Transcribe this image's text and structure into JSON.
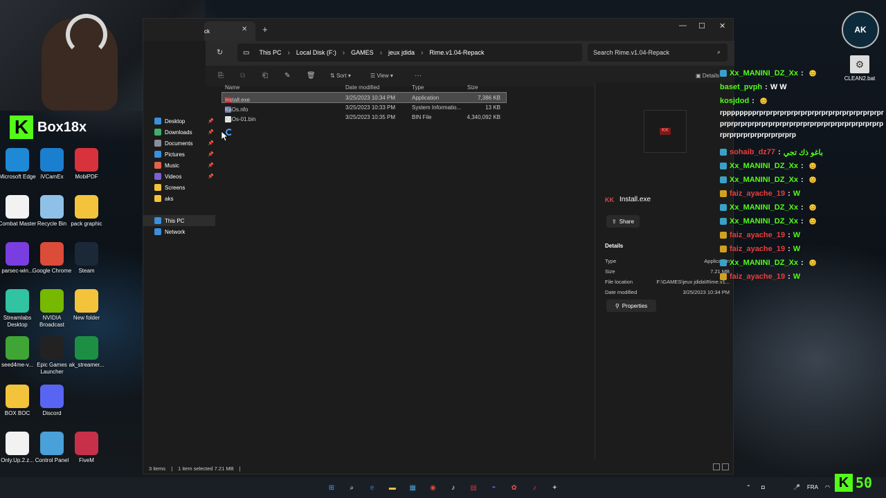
{
  "streamer": {
    "brand": "Box18x",
    "kick_count": "50",
    "logo_text": "AK"
  },
  "desktop_icons": [
    {
      "label": "Microsoft Edge",
      "icon": "edge-icon",
      "color": "#1e8ad6"
    },
    {
      "label": "iVCamEx",
      "icon": "camera-icon",
      "color": "#1b7fd0"
    },
    {
      "label": "MobiPDF",
      "icon": "pdf-icon",
      "color": "#d8323c"
    },
    {
      "label": "Combat Master",
      "icon": "file-icon",
      "color": "#f2f2f2"
    },
    {
      "label": "Recycle Bin",
      "icon": "recycle-bin-icon",
      "color": "#8fc1e8"
    },
    {
      "label": "pack graphic",
      "icon": "folder-icon",
      "color": "#f3c33c"
    },
    {
      "label": "parsec-win...",
      "icon": "parsec-icon",
      "color": "#7a3ee0"
    },
    {
      "label": "Google Chrome",
      "icon": "chrome-icon",
      "color": "#dd4b39"
    },
    {
      "label": "Steam",
      "icon": "steam-icon",
      "color": "#1b2838"
    },
    {
      "label": "Streamlabs Desktop",
      "icon": "streamlabs-icon",
      "color": "#31c3a2"
    },
    {
      "label": "NVIDIA Broadcast",
      "icon": "nvidia-icon",
      "color": "#76b900"
    },
    {
      "label": "New folder",
      "icon": "folder-icon",
      "color": "#f3c33c"
    },
    {
      "label": "seed4me-v...",
      "icon": "seed-icon",
      "color": "#3fa535"
    },
    {
      "label": "Epic Games Launcher",
      "icon": "epic-games-icon",
      "color": "#222222"
    },
    {
      "label": "ak_streamer...",
      "icon": "sheet-icon",
      "color": "#1d8f45"
    },
    {
      "label": "BOX BOC",
      "icon": "folder-icon",
      "color": "#f3c33c"
    },
    {
      "label": "Discord",
      "icon": "discord-icon",
      "color": "#5865f2"
    },
    {
      "label": "",
      "icon": "blank-icon",
      "color": "transparent"
    },
    {
      "label": "Only.Up.2.z...",
      "icon": "file-icon",
      "color": "#f2f2f2"
    },
    {
      "label": "Control Panel",
      "icon": "control-panel-icon",
      "color": "#4aa0d8"
    },
    {
      "label": "FiveM",
      "icon": "fivem-icon",
      "color": "#c8304a"
    }
  ],
  "right_desktop": {
    "label": "CLEAN2.bat"
  },
  "explorer": {
    "tab_title": "ck",
    "window_controls": {
      "minimize": "—",
      "maximize": "☐",
      "close": "✕"
    },
    "path": [
      "This PC",
      "Local Disk (F:)",
      "GAMES",
      "jeux jdida",
      "Rime.v1.04-Repack"
    ],
    "search_placeholder": "Search Rime.v1.04-Repack",
    "toolbar": {
      "sort": "Sort",
      "view": "View",
      "details": "Details"
    },
    "nav": [
      {
        "label": "Desktop",
        "icon": "desktop-icon",
        "color": "#3b8fdc",
        "pinned": true
      },
      {
        "label": "Downloads",
        "icon": "downloads-icon",
        "color": "#3fae6a",
        "pinned": true
      },
      {
        "label": "Documents",
        "icon": "documents-icon",
        "color": "#8a8fa0",
        "pinned": true
      },
      {
        "label": "Pictures",
        "icon": "pictures-icon",
        "color": "#3b8fdc",
        "pinned": true
      },
      {
        "label": "Music",
        "icon": "music-icon",
        "color": "#e0644a",
        "pinned": true
      },
      {
        "label": "Videos",
        "icon": "videos-icon",
        "color": "#7d5fd6",
        "pinned": true
      },
      {
        "label": "Screens",
        "icon": "folder-icon",
        "color": "#f3c33c",
        "pinned": false
      },
      {
        "label": "aks",
        "icon": "folder-icon",
        "color": "#f3c33c",
        "pinned": false
      },
      {
        "label": "This PC",
        "icon": "this-pc-icon",
        "color": "#3b8fdc",
        "pinned": false
      },
      {
        "label": "Network",
        "icon": "network-icon",
        "color": "#3b8fdc",
        "pinned": false
      }
    ],
    "columns": [
      "Name",
      "Date modified",
      "Type",
      "Size"
    ],
    "files": [
      {
        "name": "Install.exe",
        "date": "3/25/2023 10:34 PM",
        "type": "Application",
        "size": "7,386 KB",
        "icon": "exe-icon",
        "color": "#b03030"
      },
      {
        "name": "KaOs.nfo",
        "date": "3/25/2023 10:33 PM",
        "type": "System Informatio...",
        "size": "13 KB",
        "icon": "nfo-icon",
        "color": "#6a7aa8"
      },
      {
        "name": "KaOs-01.bin",
        "date": "3/25/2023 10:35 PM",
        "type": "BIN File",
        "size": "4,340,092 KB",
        "icon": "file-icon",
        "color": "#e8e8e8"
      }
    ],
    "details_pane": {
      "title": "Install.exe",
      "share": "Share",
      "section": "Details",
      "rows": [
        {
          "k": "Type",
          "v": "Application"
        },
        {
          "k": "Size",
          "v": "7.21 MB"
        },
        {
          "k": "File location",
          "v": "F:\\GAMES\\jeux jdida\\Rime.v1..."
        },
        {
          "k": "Date modified",
          "v": "3/25/2023 10:34 PM"
        }
      ],
      "properties": "Properties"
    },
    "status": {
      "items": "3 items",
      "selected": "1 item selected  7.21 MB"
    }
  },
  "chat": [
    {
      "user": "Xx_MANINI_DZ_Xx",
      "msg": "",
      "color": "green",
      "badge": "ub"
    },
    {
      "user": "baset_pvph",
      "msg": "W W",
      "color": "green",
      "badge": ""
    },
    {
      "user": "kosjdod",
      "msg": "",
      "color": "green",
      "badge": ""
    },
    {
      "spam": "rpppppppprprprprprprprprprprprprprprprprprprprprprprprprprprprprprprprprprprprprprprprprprprprprprprprprprprprprprp"
    },
    {
      "user": "sohaib_dz77",
      "msg": "باغو ذك تجي",
      "color": "red",
      "badge": "ub"
    },
    {
      "user": "Xx_MANINI_DZ_Xx",
      "msg": "",
      "color": "green",
      "badge": "ub"
    },
    {
      "user": "Xx_MANINI_DZ_Xx",
      "msg": "",
      "color": "green",
      "badge": "ub"
    },
    {
      "user": "faiz_ayache_19",
      "msg": "W",
      "color": "red",
      "badge": "ub2"
    },
    {
      "user": "Xx_MANINI_DZ_Xx",
      "msg": "",
      "color": "green",
      "badge": "ub"
    },
    {
      "user": "Xx_MANINI_DZ_Xx",
      "msg": "",
      "color": "green",
      "badge": "ub"
    },
    {
      "user": "faiz_ayache_19",
      "msg": "W",
      "color": "red",
      "badge": "ub2"
    },
    {
      "user": "faiz_ayache_19",
      "msg": "W",
      "color": "red",
      "badge": "ub2"
    },
    {
      "user": "Xx_MANINI_DZ_Xx",
      "msg": "",
      "color": "green",
      "badge": "ub"
    },
    {
      "user": "faiz_ayache_19",
      "msg": "W",
      "color": "red",
      "badge": "ub2"
    }
  ],
  "taskbar": {
    "apps": [
      {
        "name": "start-icon",
        "glyph": "⊞",
        "color": "#3b9cff"
      },
      {
        "name": "search-icon",
        "glyph": "⌕",
        "color": "#ffffff"
      },
      {
        "name": "edge-icon",
        "glyph": "e",
        "color": "#1e8ad6"
      },
      {
        "name": "file-explorer-icon",
        "glyph": "▬",
        "color": "#f3c33c"
      },
      {
        "name": "store-icon",
        "glyph": "▦",
        "color": "#4aa0d8"
      },
      {
        "name": "chrome-icon",
        "glyph": "◉",
        "color": "#dd4b39"
      },
      {
        "name": "tiktok-icon",
        "glyph": "♪",
        "color": "#ffffff"
      },
      {
        "name": "news-icon",
        "glyph": "▤",
        "color": "#d8323c"
      },
      {
        "name": "discord-icon",
        "glyph": "◓",
        "color": "#5865f2"
      },
      {
        "name": "app-icon",
        "glyph": "✿",
        "color": "#e05050"
      },
      {
        "name": "tiktok-live-icon",
        "glyph": "♪",
        "color": "#ff2d55"
      },
      {
        "name": "steam-icon",
        "glyph": "✦",
        "color": "#9fb8cf"
      }
    ],
    "lang": "FRA"
  }
}
